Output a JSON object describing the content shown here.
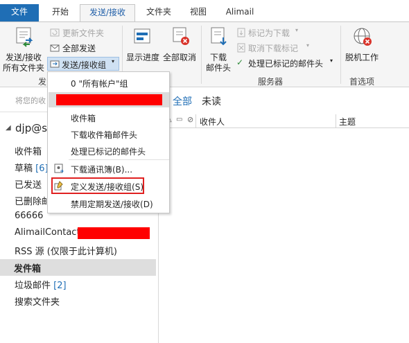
{
  "tabs": [
    {
      "label": "文件"
    },
    {
      "label": "开始"
    },
    {
      "label": "发送/接收"
    },
    {
      "label": "文件夹"
    },
    {
      "label": "视图"
    },
    {
      "label": "Alimail"
    }
  ],
  "ribbon": {
    "send_receive_all_line1": "发送/接收",
    "send_receive_all_line2": "所有文件夹",
    "update_folder": "更新文件夹",
    "send_all": "全部发送",
    "send_receive_groups": "发送/接收组",
    "show_progress": "显示进度",
    "cancel_all": "全部取消",
    "download_headers_line1": "下载",
    "download_headers_line2": "邮件头",
    "mark_to_download": "标记为下载",
    "unmark_to_download": "取消下载标记",
    "process_marked_headers": "处理已标记的邮件头",
    "work_offline": "脱机工作",
    "group_send_receive_partial": "发",
    "group_server": "服务器",
    "group_preferences": "首选项"
  },
  "toolbar": {
    "drag_hint_partial": "将您的收",
    "filter_all": "全部",
    "filter_unread": "未读"
  },
  "message_list": {
    "col_from": "收件人",
    "col_subject": "主题"
  },
  "account": {
    "name_partial": "djp@s"
  },
  "folders": [
    {
      "label": "收件箱",
      "count": ""
    },
    {
      "label": "草稿",
      "count": "[6]"
    },
    {
      "label": "已发送",
      "count": ""
    },
    {
      "label": "已删除邮",
      "count": ""
    },
    {
      "label": "66666",
      "count": ""
    },
    {
      "label": "AlimailContact",
      "count": ""
    },
    {
      "label": "RSS 源 (仅限于此计算机)",
      "count": ""
    },
    {
      "label": "发件箱",
      "count": ""
    },
    {
      "label": "垃圾邮件",
      "count": "[2]"
    },
    {
      "label": "搜索文件夹",
      "count": ""
    }
  ],
  "menu": {
    "item_all_accounts": "0 \"所有帐户\"组",
    "item_inbox": "收件箱",
    "item_download_inbox_headers": "下载收件箱邮件头",
    "item_process_marked": "处理已标记的邮件头",
    "item_download_addressbook": "下载通讯簿(B)...",
    "item_define_groups": "定义发送/接收组(S)",
    "item_disable_scheduled": "禁用定期发送/接收(D)"
  },
  "colors": {
    "accent": "#1f6eb5",
    "highlight_box": "#e02020",
    "redaction": "#ff0000",
    "selected_folder_bg": "#dedede"
  }
}
